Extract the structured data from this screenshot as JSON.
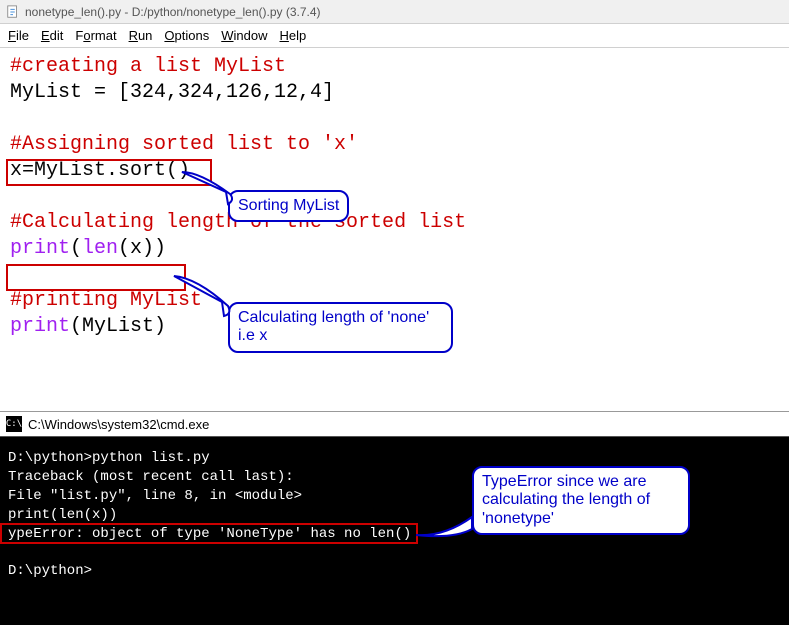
{
  "titlebar": {
    "text": "nonetype_len().py - D:/python/nonetype_len().py (3.7.4)"
  },
  "menu": {
    "file": "File",
    "edit": "Edit",
    "format": "Format",
    "run": "Run",
    "options": "Options",
    "window": "Window",
    "help": "Help"
  },
  "code": {
    "c1": "#creating a list MyList",
    "l2a": "MyList = [324,324,126,12,4]",
    "c2": "#Assigning sorted list to 'x'",
    "l4a": "x=MyList.sort()",
    "c3": "#Calculating length of the sorted list",
    "l6_print": "print",
    "l6_len": "len",
    "l6_x": "(x))",
    "l6_open": "(",
    "c4": "#printing MyList",
    "l8_print": "print",
    "l8_rest": "(MyList)"
  },
  "callouts": {
    "sort": "Sorting MyList",
    "len1": "Calculating length of 'none'",
    "len2": "i.e x",
    "err1": "TypeError since we are",
    "err2": "calculating the length of",
    "err3": "'nonetype'"
  },
  "cmd": {
    "title": "C:\\Windows\\system32\\cmd.exe",
    "l1": "D:\\python>python list.py",
    "l2": "Traceback (most recent call last):",
    "l3": "  File \"list.py\", line 8, in <module>",
    "l4": "    print(len(x))",
    "l5": "ypeError: object of type 'NoneType' has no len()",
    "l6": "D:\\python>"
  }
}
